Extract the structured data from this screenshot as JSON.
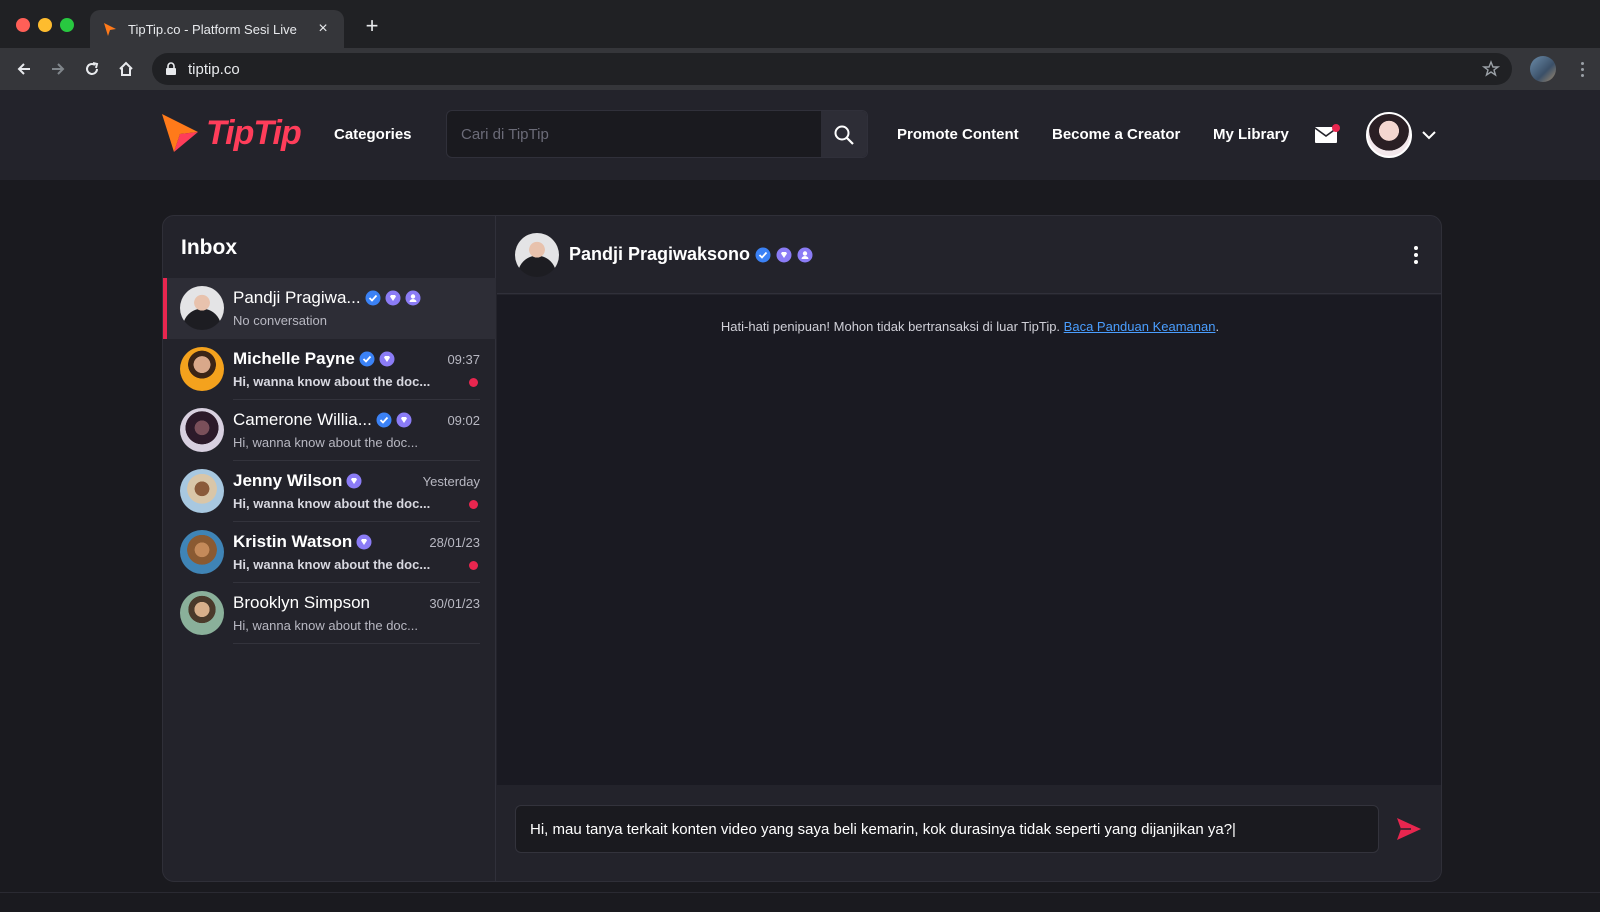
{
  "browser": {
    "tab_title": "TipTip.co - Platform Sesi Live",
    "url": "tiptip.co",
    "close_symbol": "×",
    "new_tab_symbol": "+"
  },
  "header": {
    "logo_text": "TipTip",
    "categories": "Categories",
    "search_placeholder": "Cari di TipTip",
    "promote": "Promote Content",
    "become_creator": "Become a Creator",
    "my_library": "My Library"
  },
  "inbox": {
    "title": "Inbox",
    "conversations": [
      {
        "name": "Pandji Pragiwa...",
        "preview": "No conversation",
        "time": "",
        "unread": false,
        "active": true
      },
      {
        "name": "Michelle Payne",
        "preview": "Hi, wanna know about the doc...",
        "time": "09:37",
        "unread": true,
        "active": false
      },
      {
        "name": "Camerone Willia...",
        "preview": "Hi, wanna know about the doc...",
        "time": "09:02",
        "unread": false,
        "active": false
      },
      {
        "name": "Jenny Wilson",
        "preview": "Hi, wanna know about the doc...",
        "time": "Yesterday",
        "unread": true,
        "active": false
      },
      {
        "name": "Kristin Watson",
        "preview": "Hi, wanna know about the doc...",
        "time": "28/01/23",
        "unread": true,
        "active": false
      },
      {
        "name": "Brooklyn Simpson",
        "preview": "Hi, wanna know about the doc...",
        "time": "30/01/23",
        "unread": false,
        "active": false
      }
    ]
  },
  "chat": {
    "name": "Pandji Pragiwaksono",
    "warning_text": "Hati-hati penipuan! Mohon tidak bertransaksi di luar TipTip. ",
    "warning_link": "Baca Panduan Keamanan",
    "warning_suffix": ".",
    "message_value": "Hi, mau tanya terkait konten video yang saya beli kemarin, kok durasinya tidak seperti yang dijanjikan ya?|"
  },
  "colors": {
    "accent": "#e8264f",
    "link": "#4a9eff",
    "verified": "#3b82f6",
    "badge_purple": "#8b7cf6"
  }
}
